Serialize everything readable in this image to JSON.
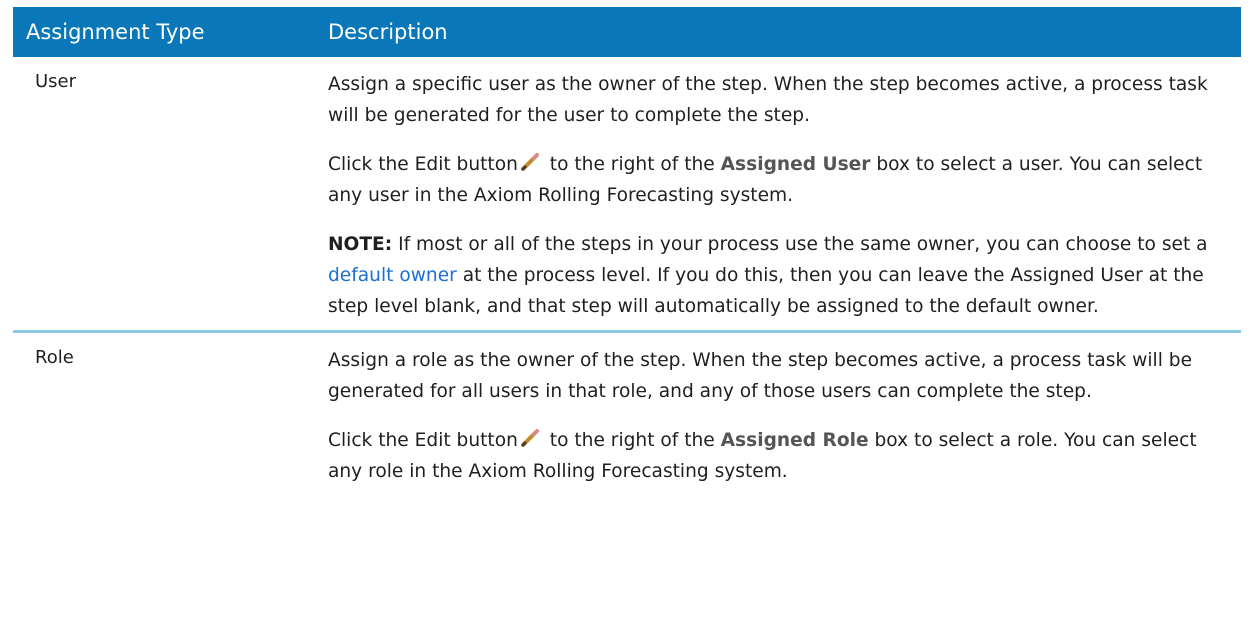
{
  "table": {
    "headers": {
      "type": "Assignment Type",
      "description": "Description"
    },
    "rows": [
      {
        "type": "User",
        "p1": "Assign a specific user as the owner of the step. When the step becomes active, a process task will be generated for the user to complete the step.",
        "p2_before_icon": "Click the Edit button",
        "p2_after_icon": " to the right of the ",
        "p2_bold": "Assigned User",
        "p2_end": " box to select a user. You can select any user in the Axiom Rolling Forecasting system.",
        "note_label": "NOTE:",
        "note_before_link": " If most or all of the steps in your process use the same owner, you can choose to set a ",
        "note_link": "default owner",
        "note_after_link": " at the process level. If you do this, then you can leave the Assigned User at the step level blank, and that step will automatically be assigned to the default owner."
      },
      {
        "type": "Role",
        "p1": "Assign a role as the owner of the step. When the step becomes active, a process task will be generated for all users in that role, and any of those users can complete the step.",
        "p2_before_icon": "Click the Edit button",
        "p2_after_icon": " to the right of the ",
        "p2_bold": "Assigned Role",
        "p2_end": " box to select a role. You can select any role in the Axiom Rolling Forecasting system."
      }
    ]
  },
  "colors": {
    "header_bg": "#0a78b8",
    "row_divider": "#8ccbe6",
    "link": "#1a6fd0"
  },
  "icons": {
    "edit": "pencil-icon"
  }
}
